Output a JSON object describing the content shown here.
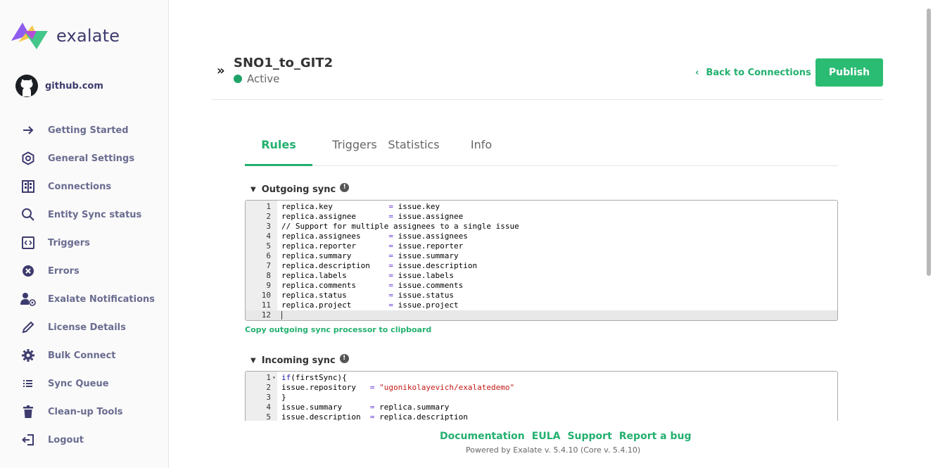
{
  "brand": {
    "name": "exalate"
  },
  "instance": {
    "label": "github.com"
  },
  "sidebar": {
    "items": [
      {
        "label": "Getting Started",
        "icon": "arrow-right-icon"
      },
      {
        "label": "General Settings",
        "icon": "hexagon-settings-icon"
      },
      {
        "label": "Connections",
        "icon": "building-icon"
      },
      {
        "label": "Entity Sync status",
        "icon": "search-icon"
      },
      {
        "label": "Triggers",
        "icon": "code-brackets-icon"
      },
      {
        "label": "Errors",
        "icon": "error-x-icon"
      },
      {
        "label": "Exalate Notifications",
        "icon": "user-at-icon"
      },
      {
        "label": "License Details",
        "icon": "pencil-icon"
      },
      {
        "label": "Bulk Connect",
        "icon": "gear-icon"
      },
      {
        "label": "Sync Queue",
        "icon": "list-icon"
      },
      {
        "label": "Clean-up Tools",
        "icon": "trash-icon"
      },
      {
        "label": "Logout",
        "icon": "logout-icon"
      }
    ]
  },
  "header": {
    "collapse_glyph": "»",
    "title": "SNO1_to_GIT2",
    "status": "Active",
    "back_label": "Back to Connections",
    "publish_label": "Publish"
  },
  "tabs": [
    {
      "label": "Rules",
      "active": true
    },
    {
      "label": "Triggers",
      "active": false
    },
    {
      "label": "Statistics",
      "active": false
    },
    {
      "label": "Info",
      "active": false
    }
  ],
  "outgoing": {
    "title": "Outgoing sync",
    "copy_label": "Copy outgoing sync processor to clipboard",
    "lines": [
      {
        "n": "1",
        "code": "replica.key            = issue.key"
      },
      {
        "n": "2",
        "code": "replica.assignee       = issue.assignee"
      },
      {
        "n": "3",
        "code": "// Support for multiple assignees to a single issue",
        "comment": true
      },
      {
        "n": "4",
        "code": "replica.assignees      = issue.assignees"
      },
      {
        "n": "5",
        "code": "replica.reporter       = issue.reporter"
      },
      {
        "n": "6",
        "code": "replica.summary        = issue.summary"
      },
      {
        "n": "7",
        "code": "replica.description    = issue.description"
      },
      {
        "n": "8",
        "code": "replica.labels         = issue.labels"
      },
      {
        "n": "9",
        "code": "replica.comments       = issue.comments"
      },
      {
        "n": "10",
        "code": "replica.status         = issue.status"
      },
      {
        "n": "11",
        "code": "replica.project        = issue.project"
      },
      {
        "n": "12",
        "code": "",
        "current": true
      }
    ]
  },
  "incoming": {
    "title": "Incoming sync",
    "lines": [
      {
        "n": "1",
        "code": "if(firstSync){",
        "fold": true
      },
      {
        "n": "2",
        "code": "issue.repository   = \"ugonikolayevich/exalatedemo\""
      },
      {
        "n": "3",
        "code": "}"
      },
      {
        "n": "4",
        "code": "issue.summary      = replica.summary"
      },
      {
        "n": "5",
        "code": "issue.description  = replica.description"
      }
    ]
  },
  "footer": {
    "links": [
      "Documentation",
      "EULA",
      "Support",
      "Report a bug"
    ],
    "powered": "Powered by Exalate v. 5.4.10 (Core v. 5.4.10)"
  },
  "colors": {
    "accent": "#23b06f",
    "publish_bg": "#2bbc73",
    "nav_text": "#6a6c90",
    "brand_text": "#3d3b6e"
  }
}
